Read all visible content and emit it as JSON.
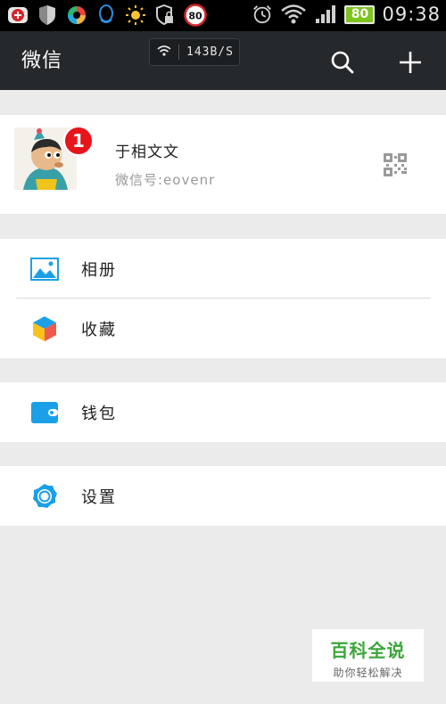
{
  "status_bar": {
    "icons": [
      "record-app-icon",
      "shield-icon",
      "colorful-app-icon",
      "qq-penguin-icon",
      "brightness-icon",
      "lock-shield-icon",
      "speed-limit-80-icon"
    ],
    "speed_limit": "80",
    "battery": "80",
    "time": "09:38"
  },
  "action_bar": {
    "title": "微信",
    "network_speed": "143B/S",
    "icons": [
      "search-icon",
      "plus-icon"
    ]
  },
  "profile": {
    "nickname": "于相文文",
    "wechat_id": "微信号:eovenr",
    "badge_count": "1"
  },
  "menu": {
    "album": "相册",
    "favorites": "收藏",
    "wallet": "钱包",
    "settings": "设置"
  },
  "watermark": {
    "title": "百科全说",
    "subtitle": "助你轻松解决"
  },
  "colors": {
    "action_bar": "#25292c",
    "accent_blue": "#1ba0e8",
    "badge_red": "#e8141b",
    "battery_green": "#7fc31f"
  }
}
